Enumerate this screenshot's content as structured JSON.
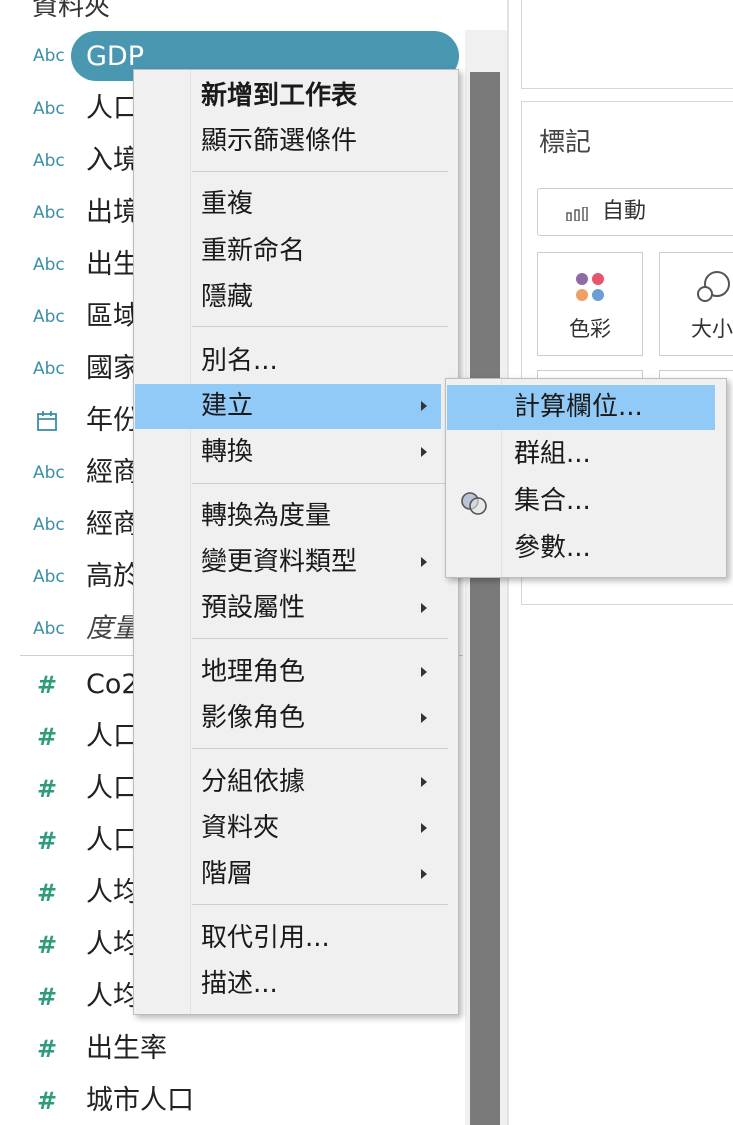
{
  "data_pane": {
    "header": "資料夾",
    "selected_field": {
      "type": "Abc",
      "name": "GDP"
    },
    "dimensions": [
      {
        "type": "Abc",
        "name": "人口"
      },
      {
        "type": "Abc",
        "name": "入境"
      },
      {
        "type": "Abc",
        "name": "出境"
      },
      {
        "type": "Abc",
        "name": "出生"
      },
      {
        "type": "Abc",
        "name": "區域"
      },
      {
        "type": "Abc",
        "name": "國家"
      },
      {
        "type": "calendar-icon",
        "name": "年份"
      },
      {
        "type": "Abc",
        "name": "經商"
      },
      {
        "type": "Abc",
        "name": "經商"
      },
      {
        "type": "Abc",
        "name": "高於"
      },
      {
        "type": "Abc",
        "name": "度量"
      }
    ],
    "measures": [
      {
        "type": "#",
        "name": "Co2"
      },
      {
        "type": "#",
        "name": "人口"
      },
      {
        "type": "#",
        "name": "人口"
      },
      {
        "type": "#",
        "name": "人口"
      },
      {
        "type": "#",
        "name": "人均"
      },
      {
        "type": "#",
        "name": "人均"
      },
      {
        "type": "#",
        "name": "人均"
      },
      {
        "type": "#",
        "name": "出生率"
      },
      {
        "type": "#",
        "name": "城市人口"
      }
    ]
  },
  "marks": {
    "title": "標記",
    "mark_type": "自動",
    "buttons": {
      "color": "色彩",
      "size": "大小"
    },
    "colors": {
      "dot1": "#8e6aa6",
      "dot2": "#e8546b",
      "dot3": "#f0a064",
      "dot4": "#6a9fd4"
    }
  },
  "context_menu": {
    "items": [
      {
        "label": "新增到工作表",
        "bold": true
      },
      {
        "label": "顯示篩選條件"
      },
      {
        "label": "重複"
      },
      {
        "label": "重新命名"
      },
      {
        "label": "隱藏"
      },
      {
        "label": "別名..."
      },
      {
        "label": "建立",
        "submenu": true,
        "highlighted": true
      },
      {
        "label": "轉換",
        "submenu": true
      },
      {
        "label": "轉換為度量"
      },
      {
        "label": "變更資料類型",
        "submenu": true
      },
      {
        "label": "預設屬性",
        "submenu": true
      },
      {
        "label": "地理角色",
        "submenu": true
      },
      {
        "label": "影像角色",
        "submenu": true
      },
      {
        "label": "分組依據",
        "submenu": true
      },
      {
        "label": "資料夾",
        "submenu": true
      },
      {
        "label": "階層",
        "submenu": true
      },
      {
        "label": "取代引用..."
      },
      {
        "label": "描述..."
      }
    ]
  },
  "create_submenu": {
    "items": [
      {
        "label": "計算欄位...",
        "highlighted": true
      },
      {
        "label": "群組..."
      },
      {
        "label": "集合...",
        "icon": "sets-icon"
      },
      {
        "label": "參數..."
      }
    ]
  },
  "colors": {
    "accent": "#4a97b1",
    "highlight": "#91c9f7",
    "menu_bg": "#f0f0f0"
  }
}
